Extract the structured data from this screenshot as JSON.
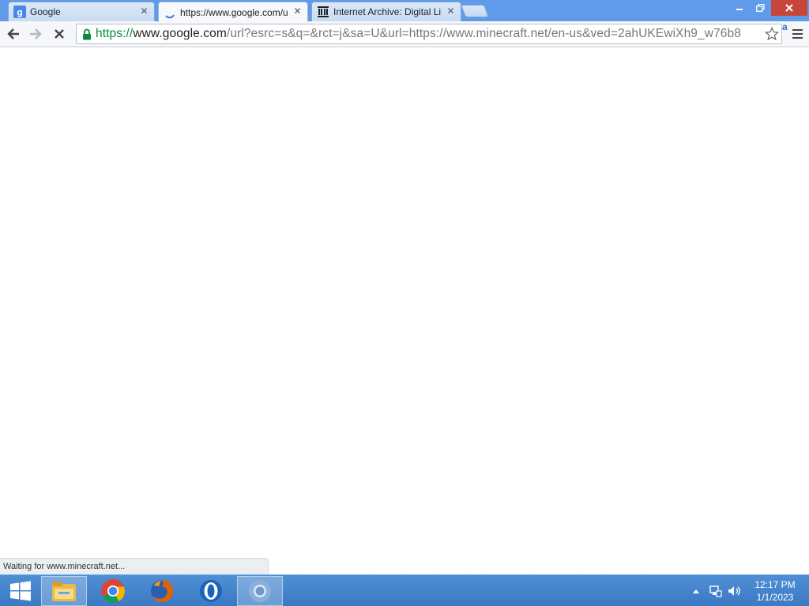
{
  "browser": {
    "tabs": [
      {
        "title": "Google",
        "favicon": "google-g-icon",
        "active": false
      },
      {
        "title": "https://www.google.com/url?",
        "favicon": "loading-spinner-icon",
        "active": true
      },
      {
        "title": "Internet Archive: Digital Library",
        "favicon": "internet-archive-icon",
        "active": false
      }
    ],
    "close_glyph": "✕",
    "omnibox": {
      "scheme": "https://",
      "host": "www.google.com",
      "path": "/url?esrc=s&q=&rct=j&sa=U&url=https://www.minecraft.net/en-us&ved=2ahUKEwiXh9_w76b8"
    },
    "extension_badge": "a",
    "status_text": "Waiting for www.minecraft.net..."
  },
  "taskbar": {
    "apps": [
      {
        "name": "file-explorer-icon",
        "active": true
      },
      {
        "name": "chrome-icon",
        "active": false
      },
      {
        "name": "firefox-icon",
        "active": false
      },
      {
        "name": "opera-icon",
        "active": false
      },
      {
        "name": "chrome-window-icon",
        "active": true
      }
    ],
    "clock": {
      "time": "12:17 PM",
      "date": "1/1/2023"
    }
  },
  "colors": {
    "accent": "#5f9be8",
    "secure_green": "#0a8a3a",
    "taskbar": "#3b7ac4",
    "close_red": "#c7463b"
  }
}
